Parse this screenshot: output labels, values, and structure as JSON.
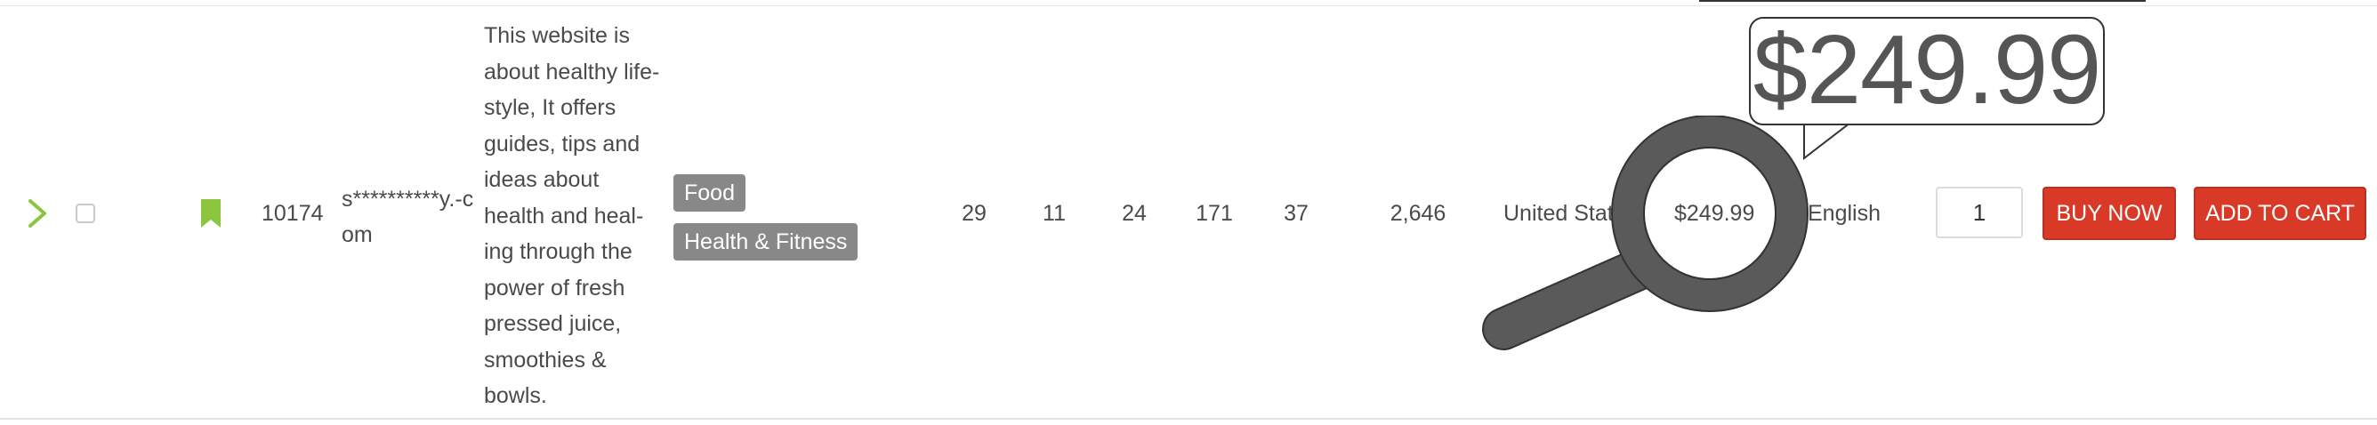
{
  "row": {
    "id": "10174",
    "domain": "s**********y.-com",
    "description_lines": [
      "This website is",
      "about healthy life-",
      "style, It offers",
      "guides, tips and",
      "ideas about",
      "health and heal-",
      "ing through the",
      "power of fresh",
      "pressed juice,",
      "smoothies &",
      "bowls."
    ],
    "categories": [
      "Food",
      "Health & Fitness"
    ],
    "metrics": [
      "29",
      "11",
      "24",
      "171",
      "37"
    ],
    "traffic": "2,646",
    "country": "United States",
    "price": "$249.99",
    "language": "English",
    "quantity": "1",
    "buy_now_label": "BUY NOW",
    "add_to_cart_label": "ADD TO CART"
  },
  "zoom": {
    "text": "$249.99"
  },
  "colors": {
    "accent_green": "#8cc63f",
    "button_red": "#d93a27",
    "tag_gray": "#888888"
  }
}
